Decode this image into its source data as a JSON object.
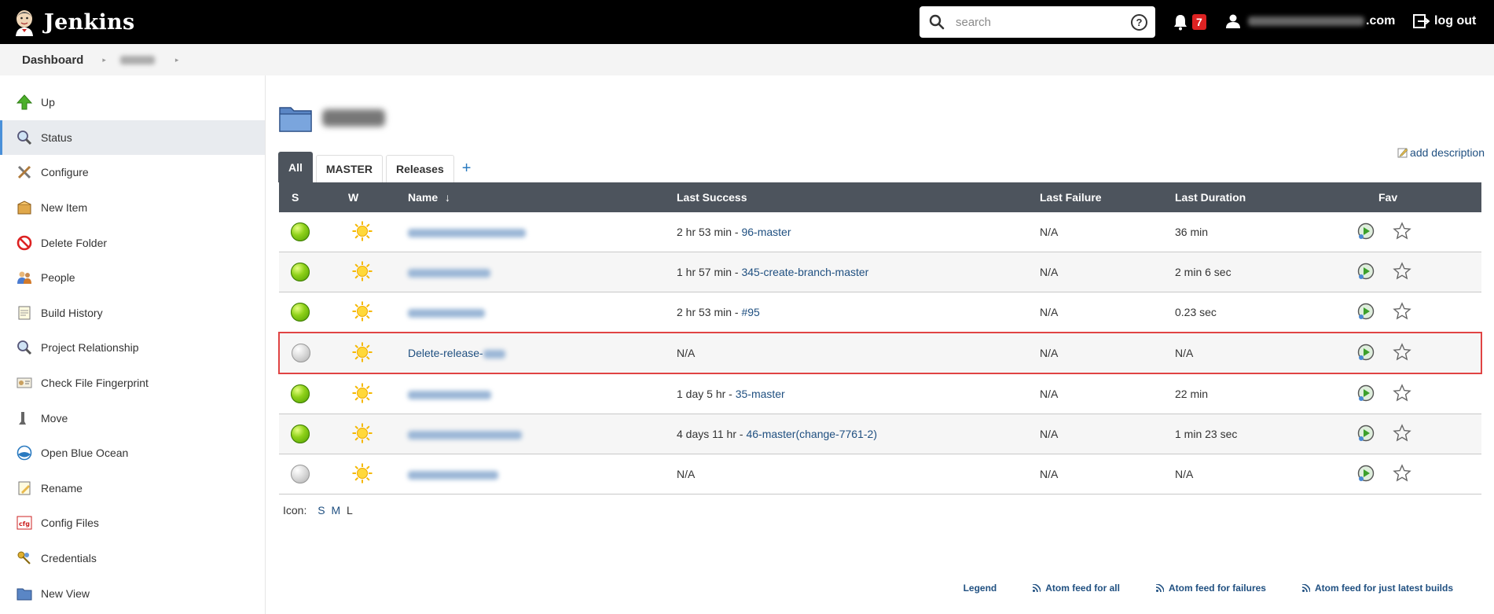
{
  "header": {
    "brand": "Jenkins",
    "search_placeholder": "search",
    "help_symbol": "?",
    "notification_count": "7",
    "user_suffix": ".com",
    "logout_label": "log out"
  },
  "breadcrumb": {
    "dashboard": "Dashboard"
  },
  "sidebar": {
    "items": [
      {
        "label": "Up",
        "icon": "up-arrow-icon"
      },
      {
        "label": "Status",
        "icon": "magnifier-icon"
      },
      {
        "label": "Configure",
        "icon": "tools-icon"
      },
      {
        "label": "New Item",
        "icon": "package-icon"
      },
      {
        "label": "Delete Folder",
        "icon": "no-entry-icon"
      },
      {
        "label": "People",
        "icon": "people-icon"
      },
      {
        "label": "Build History",
        "icon": "notepad-icon"
      },
      {
        "label": "Project Relationship",
        "icon": "search-icon"
      },
      {
        "label": "Check File Fingerprint",
        "icon": "fingerprint-icon"
      },
      {
        "label": "Move",
        "icon": "move-icon"
      },
      {
        "label": "Open Blue Ocean",
        "icon": "blue-ocean-icon"
      },
      {
        "label": "Rename",
        "icon": "rename-icon"
      },
      {
        "label": "Config Files",
        "icon": "cfg-icon"
      },
      {
        "label": "Credentials",
        "icon": "keys-icon"
      },
      {
        "label": "New View",
        "icon": "folder-icon"
      }
    ],
    "active_index": 1
  },
  "main": {
    "add_description": "add description",
    "tabs": [
      "All",
      "MASTER",
      "Releases"
    ],
    "tab_add": "+",
    "table": {
      "headers": {
        "s": "S",
        "w": "W",
        "name": "Name",
        "sort": "↓",
        "last_success": "Last Success",
        "last_failure": "Last Failure",
        "last_duration": "Last Duration",
        "fav": "Fav"
      },
      "rows": [
        {
          "status": "blue",
          "name": "",
          "success_time": "2 hr 53 min - ",
          "success_link": "96-master",
          "failure": "N/A",
          "duration": "36 min"
        },
        {
          "status": "blue",
          "name": "",
          "success_time": "1 hr 57 min - ",
          "success_link": "345-create-branch-master",
          "failure": "N/A",
          "duration": "2 min 6 sec"
        },
        {
          "status": "blue",
          "name": "",
          "success_time": "2 hr 53 min - ",
          "success_link": "#95",
          "failure": "N/A",
          "duration": "0.23 sec"
        },
        {
          "status": "grey",
          "name": "Delete-release-",
          "success_time": "N/A",
          "success_link": "",
          "failure": "N/A",
          "duration": "N/A"
        },
        {
          "status": "blue",
          "name": "",
          "success_time": "1 day 5 hr - ",
          "success_link": "35-master",
          "failure": "N/A",
          "duration": "22 min"
        },
        {
          "status": "blue",
          "name": "",
          "success_time": "4 days 11 hr - ",
          "success_link": "46-master(change-7761-2)",
          "failure": "N/A",
          "duration": "1 min 23 sec"
        },
        {
          "status": "grey",
          "name": "",
          "success_time": "N/A",
          "success_link": "",
          "failure": "N/A",
          "duration": "N/A"
        }
      ]
    },
    "icon_size": {
      "label": "Icon:",
      "s": "S",
      "m": "M",
      "l": "L"
    },
    "footer_links": [
      "Legend",
      "Atom feed for all",
      "Atom feed for failures",
      "Atom feed for just latest builds"
    ]
  }
}
